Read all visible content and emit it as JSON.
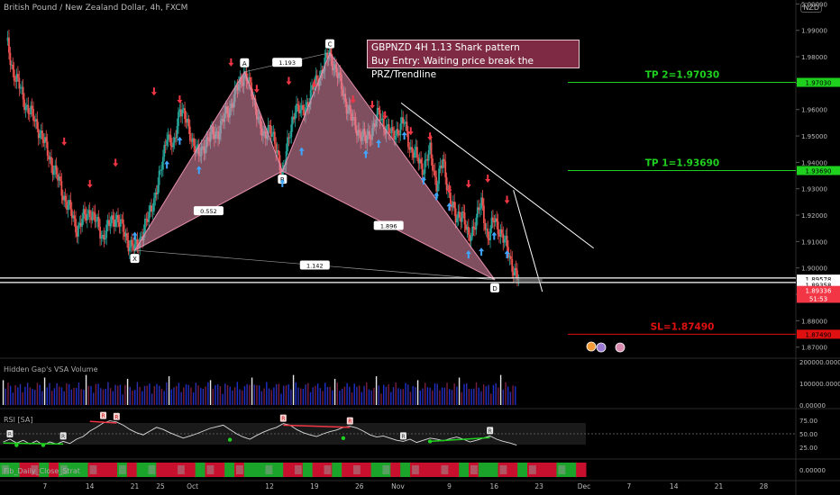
{
  "header": {
    "symbol": "British Pound / New Zealand Dollar, 4h, FXCM",
    "currency_badge": "NZD"
  },
  "annotation": {
    "line1": "GBPNZD 4H 1.13 Shark pattern",
    "line2": "Buy Entry: Waiting price break the PRZ/Trendline"
  },
  "levels": {
    "tp2": {
      "label": "TP 2=1.97030",
      "price": 1.9703,
      "color": "#1fd01f"
    },
    "tp1": {
      "label": "TP 1=1.93690",
      "price": 1.9369,
      "color": "#1fd01f"
    },
    "sl": {
      "label": "SL=1.87490",
      "price": 1.8749,
      "color": "#e01010"
    }
  },
  "pattern": {
    "points": [
      {
        "name": "X",
        "time": 21.0,
        "price": 1.9067
      },
      {
        "name": "A",
        "time": 38.1,
        "price": 1.9743
      },
      {
        "name": "B",
        "time": 44.0,
        "price": 1.9367
      },
      {
        "name": "C",
        "time": 51.4,
        "price": 1.9815
      },
      {
        "name": "D",
        "time": 77.1,
        "price": 1.8955
      }
    ],
    "ratios": [
      {
        "text": "1.193",
        "between": [
          "A",
          "C"
        ]
      },
      {
        "text": "0.552",
        "between": [
          "X",
          "B"
        ]
      },
      {
        "text": "1.896",
        "between": [
          "B",
          "D"
        ]
      },
      {
        "text": "1.142",
        "between": [
          "X",
          "D"
        ]
      }
    ],
    "fill_color": "#e88fae"
  },
  "price_tags": [
    {
      "text": "1.89578",
      "price": 1.89578,
      "bg": "#ffffff",
      "fg": "#000000"
    },
    {
      "text": "1.89358",
      "price": 1.89358,
      "bg": "#ffffff",
      "fg": "#000000"
    },
    {
      "text": "1.89336",
      "price": 1.8915,
      "bg": "#f23645",
      "fg": "#ffffff"
    },
    {
      "text": "51:53",
      "price": 1.8885,
      "bg": "#f23645",
      "fg": "#ffffff"
    }
  ],
  "x_axis": {
    "ticks": [
      {
        "label": "7",
        "t": 7
      },
      {
        "label": "14",
        "t": 14
      },
      {
        "label": "21",
        "t": 21
      },
      {
        "label": "25",
        "t": 25
      },
      {
        "label": "Oct",
        "t": 30
      },
      {
        "label": "12",
        "t": 42
      },
      {
        "label": "19",
        "t": 49
      },
      {
        "label": "26",
        "t": 56
      },
      {
        "label": "Nov",
        "t": 62
      },
      {
        "label": "9",
        "t": 70
      },
      {
        "label": "16",
        "t": 77
      },
      {
        "label": "23",
        "t": 84
      },
      {
        "label": "Dec",
        "t": 91
      },
      {
        "label": "7",
        "t": 98
      },
      {
        "label": "14",
        "t": 105
      },
      {
        "label": "21",
        "t": 112
      },
      {
        "label": "28",
        "t": 119
      }
    ]
  },
  "chart_data": {
    "type": "candlestick",
    "y_axis_ticks": [
      "2.00000",
      "1.99000",
      "1.98000",
      "1.97000",
      "1.96000",
      "1.95000",
      "1.94000",
      "1.93000",
      "1.92000",
      "1.91000",
      "1.90000",
      "1.89000",
      "1.88000",
      "1.87000"
    ],
    "ylim": [
      1.8665,
      2.0015
    ],
    "close_path": [
      {
        "t": 1,
        "p": 1.986
      },
      {
        "t": 2,
        "p": 1.975
      },
      {
        "t": 4,
        "p": 1.962
      },
      {
        "t": 6,
        "p": 1.953
      },
      {
        "t": 8,
        "p": 1.94
      },
      {
        "t": 10,
        "p": 1.927
      },
      {
        "t": 12,
        "p": 1.915
      },
      {
        "t": 14,
        "p": 1.922
      },
      {
        "t": 16,
        "p": 1.912
      },
      {
        "t": 18,
        "p": 1.92
      },
      {
        "t": 20,
        "p": 1.91
      },
      {
        "t": 21,
        "p": 1.9067
      },
      {
        "t": 23,
        "p": 1.918
      },
      {
        "t": 25,
        "p": 1.935
      },
      {
        "t": 26,
        "p": 1.952
      },
      {
        "t": 27,
        "p": 1.944
      },
      {
        "t": 28,
        "p": 1.962
      },
      {
        "t": 29,
        "p": 1.955
      },
      {
        "t": 31,
        "p": 1.942
      },
      {
        "t": 32,
        "p": 1.948
      },
      {
        "t": 34,
        "p": 1.952
      },
      {
        "t": 36,
        "p": 1.962
      },
      {
        "t": 38.1,
        "p": 1.9743
      },
      {
        "t": 40,
        "p": 1.96
      },
      {
        "t": 41,
        "p": 1.948
      },
      {
        "t": 42,
        "p": 1.955
      },
      {
        "t": 43,
        "p": 1.944
      },
      {
        "t": 44,
        "p": 1.9367
      },
      {
        "t": 45,
        "p": 1.948
      },
      {
        "t": 46,
        "p": 1.962
      },
      {
        "t": 47,
        "p": 1.958
      },
      {
        "t": 49,
        "p": 1.969
      },
      {
        "t": 51.4,
        "p": 1.9815
      },
      {
        "t": 53,
        "p": 1.97
      },
      {
        "t": 54,
        "p": 1.962
      },
      {
        "t": 55,
        "p": 1.955
      },
      {
        "t": 57,
        "p": 1.948
      },
      {
        "t": 59,
        "p": 1.958
      },
      {
        "t": 61,
        "p": 1.95
      },
      {
        "t": 63,
        "p": 1.955
      },
      {
        "t": 64,
        "p": 1.945
      },
      {
        "t": 66,
        "p": 1.938
      },
      {
        "t": 67,
        "p": 1.944
      },
      {
        "t": 68,
        "p": 1.932
      },
      {
        "t": 69,
        "p": 1.94
      },
      {
        "t": 70,
        "p": 1.928
      },
      {
        "t": 71,
        "p": 1.918
      },
      {
        "t": 72,
        "p": 1.922
      },
      {
        "t": 73,
        "p": 1.91
      },
      {
        "t": 74,
        "p": 1.918
      },
      {
        "t": 75,
        "p": 1.924
      },
      {
        "t": 76,
        "p": 1.912
      },
      {
        "t": 77,
        "p": 1.918
      },
      {
        "t": 78,
        "p": 1.914
      },
      {
        "t": 79,
        "p": 1.907
      },
      {
        "t": 80,
        "p": 1.9
      },
      {
        "t": 81,
        "p": 1.8934
      }
    ],
    "trendlines": [
      {
        "from": {
          "t": 62.5,
          "p": 1.9625
        },
        "to": {
          "t": 92.5,
          "p": 1.9075
        }
      },
      {
        "from": {
          "t": 80,
          "p": 1.9295
        },
        "to": {
          "t": 84.5,
          "p": 1.891
        }
      }
    ],
    "prz_box": {
      "from_t": 80,
      "to_t": 84.5,
      "price_top": 1.8962,
      "price_bottom": 1.8945
    }
  },
  "panels": {
    "volume": {
      "name": "Hidden Gap's VSA Volume",
      "ticks": [
        "200000.00000",
        "100000.00000",
        "0.00000"
      ],
      "max": 200000
    },
    "rsi": {
      "name": "RSI [SA]",
      "ticks": [
        "75.00",
        "50.00",
        "25.00"
      ],
      "values": [
        35,
        40,
        33,
        38,
        31,
        37,
        29,
        35,
        31,
        36,
        32,
        40,
        45,
        55,
        62,
        70,
        74,
        72,
        66,
        58,
        52,
        48,
        55,
        62,
        58,
        52,
        47,
        42,
        46,
        50,
        55,
        60,
        63,
        66,
        58,
        50,
        44,
        40,
        47,
        53,
        58,
        62,
        69,
        66,
        58,
        52,
        48,
        45,
        50,
        54,
        57,
        62,
        64,
        61,
        55,
        48,
        44,
        46,
        42,
        38,
        36,
        40,
        34,
        38,
        42,
        40,
        37,
        41,
        44,
        40,
        35,
        38,
        42,
        46,
        40,
        36,
        33,
        29
      ],
      "markers": [
        {
          "label": "R",
          "i": 15,
          "v": 74
        },
        {
          "label": "R",
          "i": 17,
          "v": 72
        },
        {
          "label": "R",
          "i": 42,
          "v": 69
        },
        {
          "label": "R",
          "i": 52,
          "v": 64
        },
        {
          "label": "R",
          "i": 1,
          "v": 40
        },
        {
          "label": "R",
          "i": 9,
          "v": 36
        },
        {
          "label": "R",
          "i": 60,
          "v": 36
        },
        {
          "label": "R",
          "i": 73,
          "v": 46
        }
      ]
    },
    "fib": {
      "name": "Fib_Daily_Close_Strat",
      "ticks": [
        "0.00000"
      ]
    }
  }
}
